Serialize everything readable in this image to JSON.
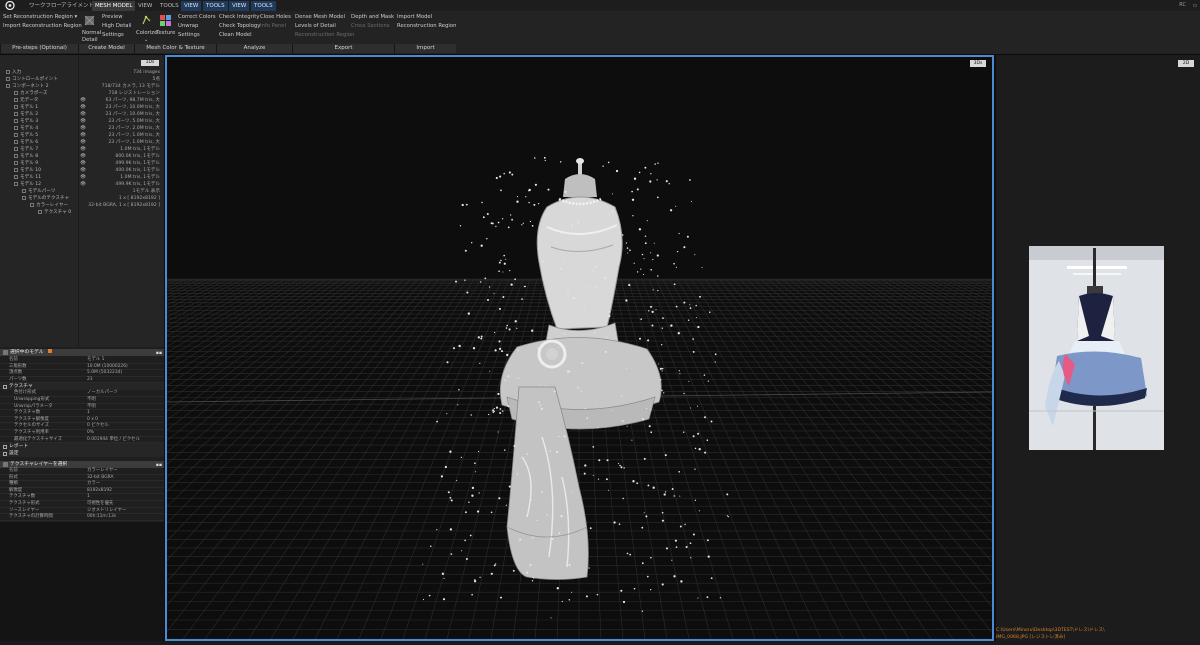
{
  "tabs": [
    {
      "label": "ワークフロー"
    },
    {
      "label": "アライメント"
    },
    {
      "label": "MESH MODEL"
    },
    {
      "label": "VIEW"
    },
    {
      "label": "TOOLS"
    },
    {
      "label": "VIEW"
    },
    {
      "label": "TOOLS"
    },
    {
      "label": "VIEW"
    },
    {
      "label": "TOOLS"
    }
  ],
  "corner_label": "RC",
  "ribbon": {
    "presteps": {
      "set_region": "Set Reconstruction Region ▾",
      "import_region": "Import Reconstruction Region",
      "group": "Pre-steps (Optional)"
    },
    "create": {
      "normal": "Normal",
      "detail": "Detail",
      "preview": "Preview",
      "high_detail": "High Detail",
      "settings": "Settings",
      "group": "Create Model"
    },
    "color": {
      "colorize": "Colorize",
      "texture": "Texture",
      "correct_colors": "Correct Colors",
      "unwrap": "Unwrap",
      "settings": "Settings",
      "group": "Mesh Color & Texture"
    },
    "analyze": {
      "check_integrity": "Check Integrity",
      "check_topology": "Check Topology",
      "clean_model": "Clean Model",
      "close_holes": "Close Holes",
      "info_panel": "Info Panel",
      "group": "Analyze"
    },
    "export": {
      "dense_mesh": "Dense Mesh Model",
      "lod": "Levels of Detail",
      "recon_region": "Reconstruction Region",
      "depth_mask": "Depth and Mask",
      "cross_sections": "Cross Sections",
      "group": "Export"
    },
    "import": {
      "import_model": "Import Model",
      "recon_region": "Reconstruction Region",
      "group": "Import"
    }
  },
  "tree": {
    "badge": "1Ds",
    "rows": [
      {
        "label": "入力",
        "indent": 0,
        "eye": "",
        "val": "734 images"
      },
      {
        "label": "コントロールポイント",
        "indent": 0,
        "eye": "",
        "val": "5点"
      },
      {
        "label": "コンポーネント 2",
        "indent": 0,
        "eye": "",
        "val": "718/734 カメラ, 13 モデル"
      },
      {
        "label": "カメラポーズ",
        "indent": 1,
        "eye": "",
        "val": "718 レジストレーション"
      },
      {
        "label": "元データ",
        "indent": 1,
        "eye": "👁",
        "val": "63 パーツ, 98.7M tris, 大"
      },
      {
        "label": "モデル 1",
        "indent": 1,
        "eye": "👁",
        "val": "23 パーツ, 10.0M tris, 大"
      },
      {
        "label": "モデル 2",
        "indent": 1,
        "eye": "👁",
        "val": "23 パーツ, 10.0M tris, 大"
      },
      {
        "label": "モデル 3",
        "indent": 1,
        "eye": "👁",
        "val": "23 パーツ, 5.0M tris, 大"
      },
      {
        "label": "モデル 4",
        "indent": 1,
        "eye": "👁",
        "val": "23 パーツ, 2.0M tris, 大"
      },
      {
        "label": "モデル 5",
        "indent": 1,
        "eye": "👁",
        "val": "23 パーツ, 1.0M tris, 大"
      },
      {
        "label": "モデル 6",
        "indent": 1,
        "eye": "👁",
        "val": "23 パーツ, 1.0M tris, 大"
      },
      {
        "label": "モデル 7",
        "indent": 1,
        "eye": "👁",
        "val": "1.0M tris, 1モデル"
      },
      {
        "label": "モデル 8",
        "indent": 1,
        "eye": "👁",
        "val": "800.0K tris, 1モデル"
      },
      {
        "label": "モデル 9",
        "indent": 1,
        "eye": "👁",
        "val": "499.9K tris, 1モデル"
      },
      {
        "label": "モデル 10",
        "indent": 1,
        "eye": "👁",
        "val": "400.0K tris, 1モデル"
      },
      {
        "label": "モデル 11",
        "indent": 1,
        "eye": "👁",
        "val": "1.0M tris, 1モデル"
      },
      {
        "label": "モデル 12",
        "indent": 1,
        "eye": "👁",
        "val": "499.9K tris, 1モデル"
      },
      {
        "label": "モデルパーツ",
        "indent": 2,
        "eye": "",
        "val": "1モデル 表示"
      },
      {
        "label": "モデルのテクスチャ",
        "indent": 2,
        "eye": "",
        "val": "1 x [ 8192x8192 ]"
      },
      {
        "label": "カラーレイヤー",
        "indent": 3,
        "eye": "",
        "val": "32-bit BGRA, 1 x [ 8192x8192 ]"
      },
      {
        "label": "テクスチャ 0",
        "indent": 4,
        "eye": "",
        "val": ""
      }
    ]
  },
  "props": {
    "header": "選択中のモデル",
    "rows": [
      {
        "k": "名前",
        "v": "モデル 1"
      },
      {
        "k": "三角形数",
        "v": "10.0M (10000226)"
      },
      {
        "k": "頂点数",
        "v": "5.0M (5032234)"
      },
      {
        "k": "パーツ数",
        "v": "23"
      }
    ],
    "texture_section": "テクスチャ",
    "tex_rows": [
      {
        "k": "色付け形式",
        "v": "ノーカルパーツ"
      },
      {
        "k": "Unwrapping形式",
        "v": "不明"
      },
      {
        "k": "Unwrapパラメータ",
        "v": "不明"
      },
      {
        "k": "テクスチャ数",
        "v": "1"
      },
      {
        "k": "テクスチャ解像度",
        "v": "0 x 0"
      },
      {
        "k": "テクセルのサイズ",
        "v": "0 ピクセル"
      },
      {
        "k": "テクスチャ利用率",
        "v": "0%"
      },
      {
        "k": "最適化テクスチャサイズ",
        "v": "0.001944 単位 / ピクセル"
      }
    ],
    "report_section": "レポート",
    "settings_section": "設定",
    "layer_header": "テクスチャレイヤーを選択",
    "layer_rows": [
      {
        "k": "名前",
        "v": "カラーレイヤー"
      },
      {
        "k": "形式",
        "v": "32-bit BGRA"
      },
      {
        "k": "種類",
        "v": "カラー"
      },
      {
        "k": "解像度",
        "v": "8192x8192"
      },
      {
        "k": "テクスチャ数",
        "v": "1"
      },
      {
        "k": "テクスチャ形式",
        "v": "可視性を優先"
      },
      {
        "k": "ソースレイヤー",
        "v": "ジオメトリレイヤー"
      },
      {
        "k": "テクスチャの計算時間",
        "v": "00h:11m:13s"
      }
    ]
  },
  "viewport3d": {
    "badge": "3Ds"
  },
  "viewport2d": {
    "badge": "2D",
    "path_line1": "C:\\Users\\Minoru\\Desktop\\3DTEST\\ドレス\\ドレス\\",
    "path_line2": "IMG_0068.JPG [レジストレ済み]"
  },
  "colors": {
    "accent": "#4b8bd6",
    "orange": "#d9822b",
    "panel": "#252525",
    "viewport_bg": "#0d0d0d"
  }
}
